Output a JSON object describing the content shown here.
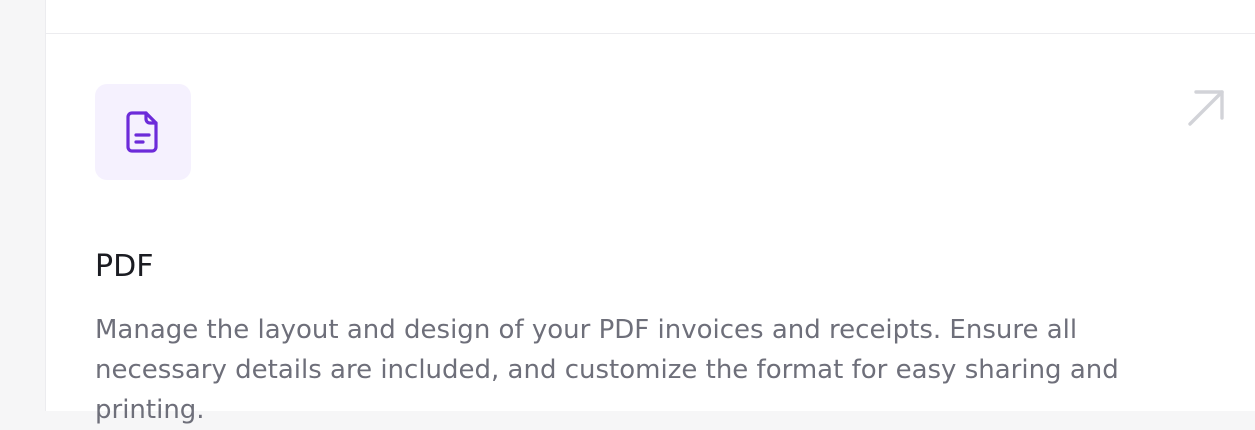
{
  "card": {
    "icon": "file-document-icon",
    "title": "PDF",
    "description": "Manage the layout and design of your PDF invoices and receipts. Ensure all necessary details are included, and customize the format for easy sharing and printing.",
    "link_icon": "arrow-up-right-icon"
  },
  "colors": {
    "accent": "#6c2bd9",
    "icon_tile_bg": "#f5f1fe",
    "title": "#1b1c22",
    "description": "#6e6f7a",
    "arrow": "#d2d3d8"
  }
}
